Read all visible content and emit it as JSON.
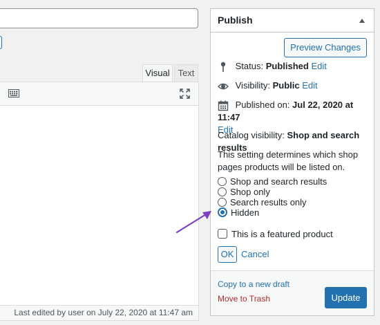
{
  "editor": {
    "tabs": [
      {
        "label": "Visual",
        "active": true
      },
      {
        "label": "Text",
        "active": false
      }
    ],
    "last_edited": "Last edited by user on July 22, 2020 at 11:47 am"
  },
  "publish": {
    "title": "Publish",
    "preview_label": "Preview Changes",
    "status_label": "Status:",
    "status_value": "Published",
    "visibility_label": "Visibility:",
    "visibility_value": "Public",
    "published_on_label": "Published on:",
    "published_on_value": "Jul 22, 2020 at 11:47",
    "edit_label": "Edit",
    "catalog_visibility_label": "Catalog visibility:",
    "catalog_visibility_value": "Shop and search results",
    "catalog_help": "This setting determines which shop pages products will be listed on.",
    "options": [
      {
        "label": "Shop and search results",
        "checked": false
      },
      {
        "label": "Shop only",
        "checked": false
      },
      {
        "label": "Search results only",
        "checked": false
      },
      {
        "label": "Hidden",
        "checked": true
      }
    ],
    "featured_label": "This is a featured product",
    "featured_checked": false,
    "ok_label": "OK",
    "cancel_label": "Cancel",
    "copy_draft_label": "Copy to a new draft",
    "trash_label": "Move to Trash",
    "update_label": "Update"
  },
  "colors": {
    "accent": "#2271b1",
    "trash": "#b32d2e",
    "arrow": "#7b3fbf"
  },
  "icons": [
    "pin-icon",
    "eye-icon",
    "calendar-icon",
    "keyboard-icon",
    "fullscreen-icon",
    "collapse-arrow-icon"
  ]
}
